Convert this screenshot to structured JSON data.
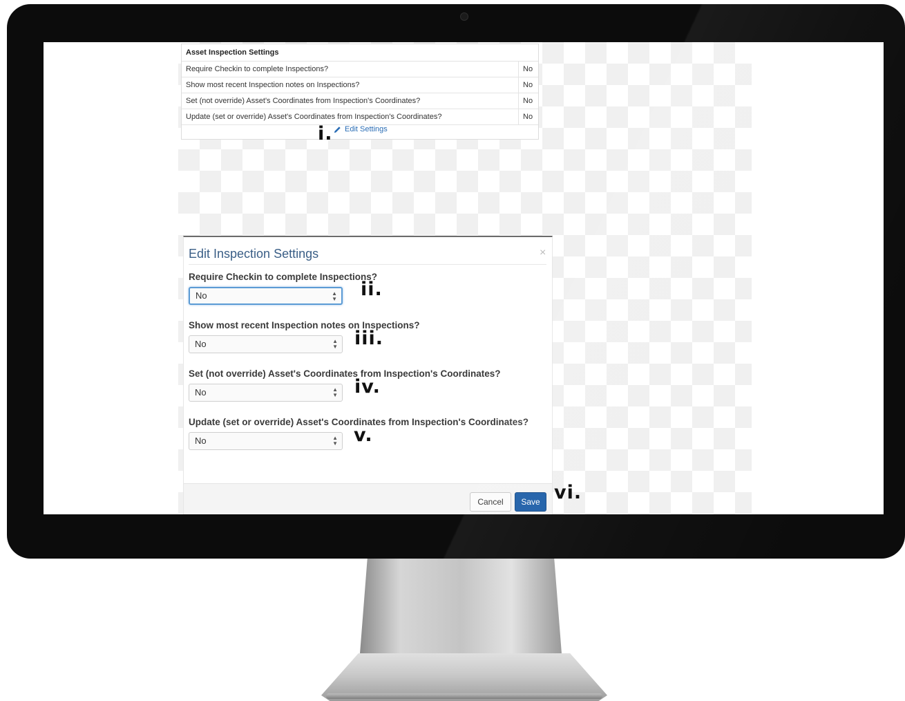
{
  "settings_panel": {
    "title": "Asset Inspection Settings",
    "rows": [
      {
        "label": "Require Checkin to complete Inspections?",
        "value": "No"
      },
      {
        "label": "Show most recent Inspection notes on Inspections?",
        "value": "No"
      },
      {
        "label": "Set (not override) Asset's Coordinates from Inspection's Coordinates?",
        "value": "No"
      },
      {
        "label": "Update (set or override) Asset's Coordinates from Inspection's Coordinates?",
        "value": "No"
      }
    ],
    "edit_link": "Edit Settings"
  },
  "modal": {
    "title": "Edit Inspection Settings",
    "close": "×",
    "fields": [
      {
        "label": "Require Checkin to complete Inspections?",
        "value": "No"
      },
      {
        "label": "Show most recent Inspection notes on Inspections?",
        "value": "No"
      },
      {
        "label": "Set (not override) Asset's Coordinates from Inspection's Coordinates?",
        "value": "No"
      },
      {
        "label": "Update (set or override) Asset's Coordinates from Inspection's Coordinates?",
        "value": "No"
      }
    ],
    "cancel_label": "Cancel",
    "save_label": "Save",
    "accent_color": "#1e5fa8"
  },
  "annotations": [
    "i.",
    "ii.",
    "iii.",
    "iv.",
    "v.",
    "vi."
  ]
}
